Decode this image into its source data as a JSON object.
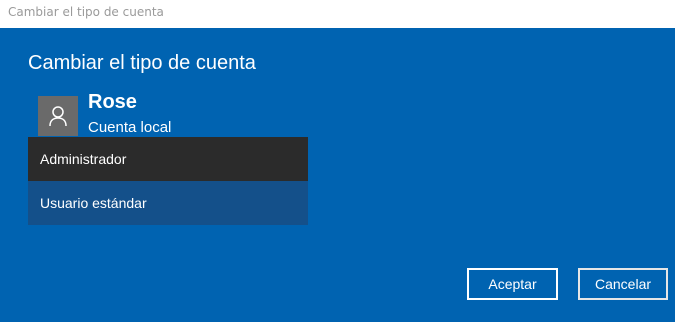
{
  "window": {
    "title": "Cambiar el tipo de cuenta"
  },
  "dialog": {
    "heading": "Cambiar el tipo de cuenta",
    "user": {
      "name": "Rose",
      "account_type": "Cuenta local",
      "avatar_icon": "user-icon"
    },
    "account_type_options": [
      {
        "label": "Administrador",
        "state": "hover"
      },
      {
        "label": "Usuario estándar",
        "state": "selected"
      }
    ],
    "buttons": {
      "accept_label": "Aceptar",
      "cancel_label": "Cancelar"
    }
  },
  "colors": {
    "background": "#0063b1",
    "titlebar": "#ffffff",
    "hover_option": "#2b2b2b",
    "selected_option": "#14508a",
    "avatar": "#6a6a6a"
  }
}
